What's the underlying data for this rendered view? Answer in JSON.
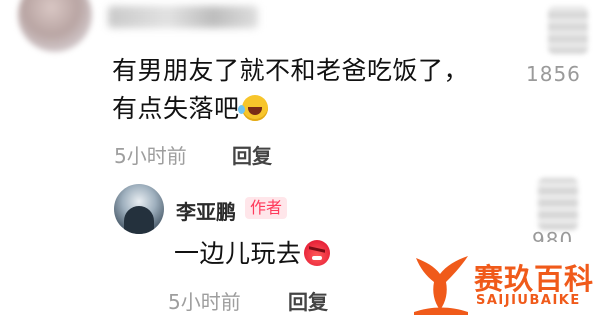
{
  "comment": {
    "text_line1": "有男朋友了就不和老爸吃饭了，",
    "text_line2": "有点失落吧",
    "emoji": "laughing-tears-icon",
    "time": "5小时前",
    "reply_label": "回复",
    "like_count": "1856"
  },
  "reply": {
    "author": "李亚鹏",
    "badge": "作者",
    "text": "一边儿玩去",
    "emoji": "angry-face-icon",
    "time": "5小时前",
    "reply_label": "回复",
    "like_count": "980"
  },
  "watermark": {
    "title": "赛玖百科",
    "subtitle": "SAIJIUBAIKE",
    "color": "#f05a1a"
  },
  "colors": {
    "badge_text": "#ff3b5c",
    "badge_bg": "#ffe6ea",
    "meta_gray": "#9e9e9e"
  }
}
